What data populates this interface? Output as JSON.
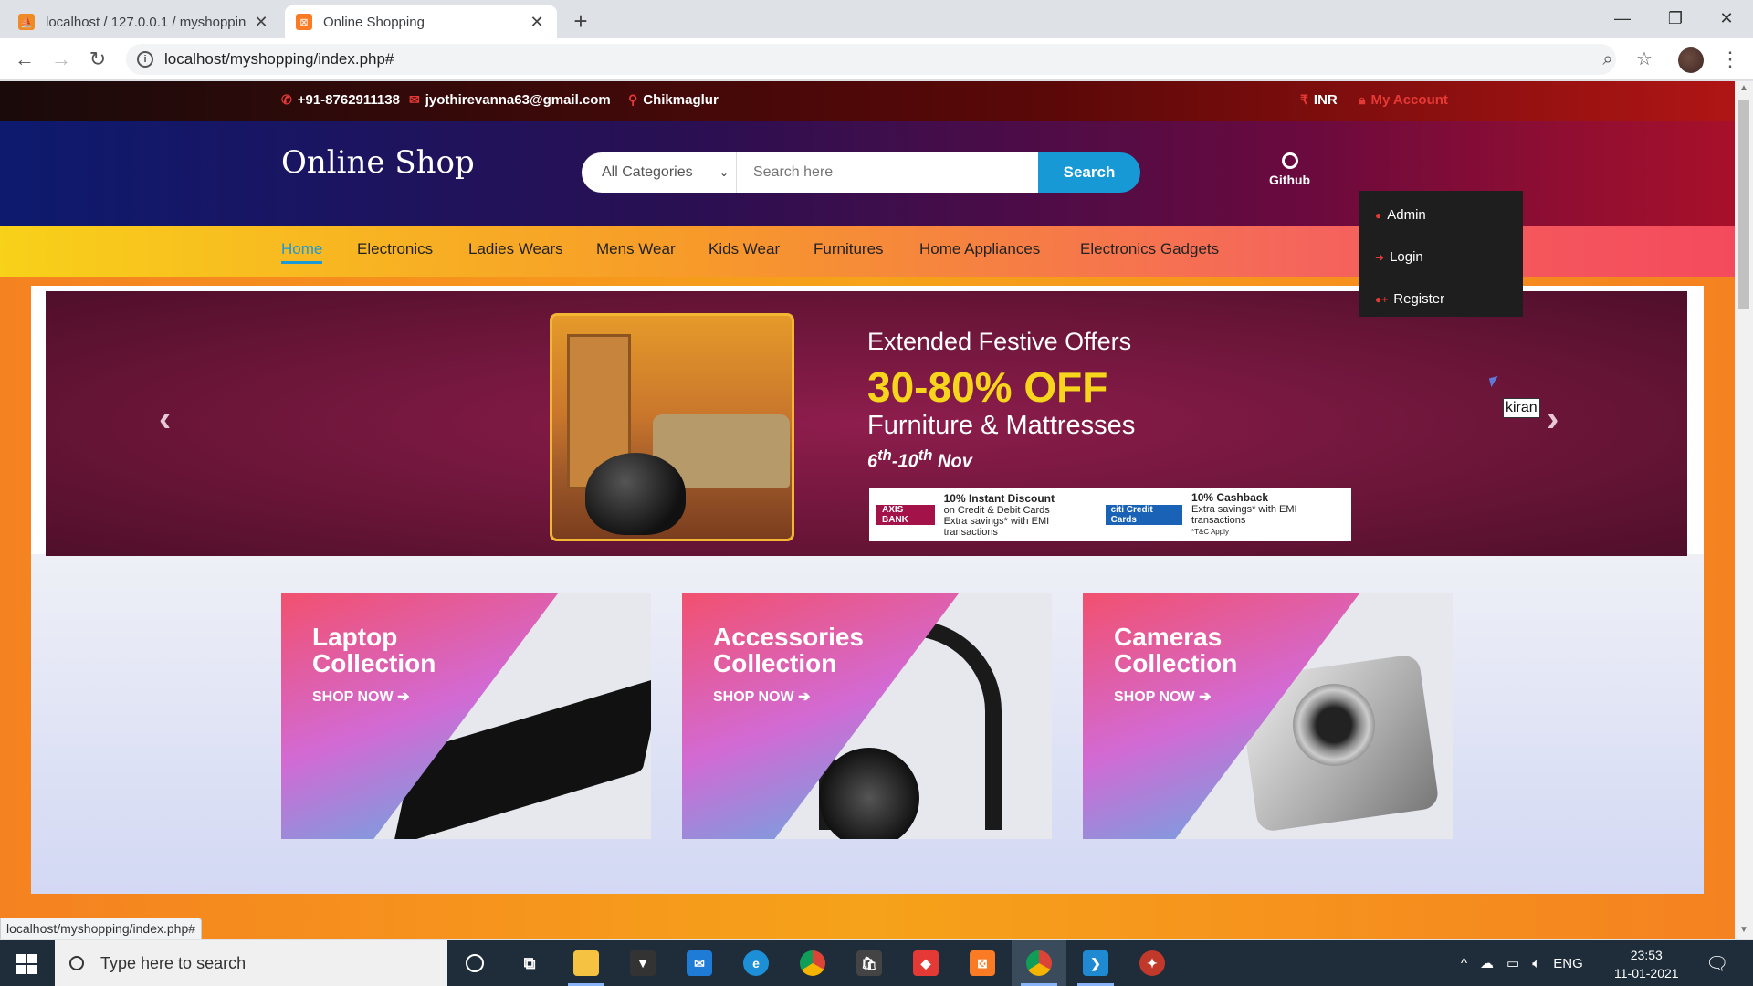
{
  "browser": {
    "tabs": [
      {
        "title": "localhost / 127.0.0.1 / myshoppin",
        "active": false
      },
      {
        "title": "Online Shopping",
        "active": true
      }
    ],
    "url": "localhost/myshopping/index.php#",
    "status_url": "localhost/myshopping/index.php#"
  },
  "topbar": {
    "phone": "+91-8762911138",
    "email": "jyothirevanna63@gmail.com",
    "location": "Chikmaglur",
    "currency": "INR",
    "account": "My Account"
  },
  "header": {
    "logo": "Online Shop",
    "category_select": "All Categories",
    "search_placeholder": "Search here",
    "search_button": "Search",
    "github_label": "Github"
  },
  "account_menu": {
    "items": [
      "Admin",
      "Login",
      "Register"
    ]
  },
  "tooltip": "kiran",
  "nav": {
    "items": [
      "Home",
      "Electronics",
      "Ladies Wears",
      "Mens Wear",
      "Kids Wear",
      "Furnitures",
      "Home Appliances",
      "Electronics Gadgets"
    ],
    "active": "Home"
  },
  "banner": {
    "headline": "Extended Festive Offers",
    "offer": "30-80% OFF",
    "subtitle": "Furniture & Mattresses",
    "dates_prefix": "6",
    "dates_sup1": "th",
    "dates_mid": "-10",
    "dates_sup2": "th",
    "dates_suffix": " Nov",
    "bank1_name": "AXIS BANK",
    "bank1_title": "10% Instant Discount",
    "bank1_line1": "on Credit & Debit Cards",
    "bank1_line2": "Extra savings* with EMI transactions",
    "bank2_name": "citi Credit Cards",
    "bank2_title": "10% Cashback",
    "bank2_line1": "Extra savings* with EMI transactions",
    "tc": "*T&C Apply"
  },
  "collections": [
    {
      "title_line1": "Laptop",
      "title_line2": "Collection",
      "cta": "SHOP NOW"
    },
    {
      "title_line1": "Accessories",
      "title_line2": "Collection",
      "cta": "SHOP NOW"
    },
    {
      "title_line1": "Cameras",
      "title_line2": "Collection",
      "cta": "SHOP NOW"
    }
  ],
  "taskbar": {
    "search_placeholder": "Type here to search",
    "language": "ENG",
    "time": "23:53",
    "date": "11-01-2021"
  },
  "colors": {
    "accent_blue": "#1699d4",
    "offer_yellow": "#f7d51d",
    "icon_red": "#e53935"
  }
}
